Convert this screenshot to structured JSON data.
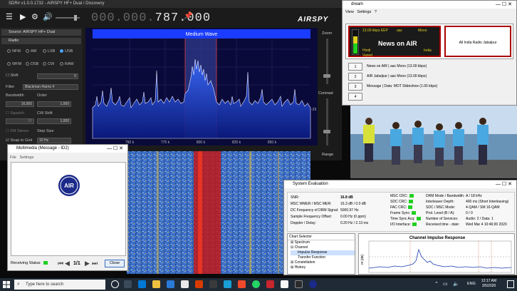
{
  "sdr": {
    "title": "SDR# v1.0.0.1732 - AIRSPY HF+ Dual / Discovery",
    "freq_prefix": "000.000.",
    "freq_main": "787.000",
    "logo": "AIRSPY",
    "source": "Source: AIRSPY HF+ Dual",
    "radio_section": "Radio",
    "modes": [
      "NFM",
      "AM",
      "LSB",
      "USB",
      "WFM",
      "DSB",
      "CW",
      "RAW"
    ],
    "selected_mode": "USB",
    "shift_label": "Shift",
    "shift_value": "0",
    "filter_label": "Filter",
    "filter_value": "Blackman-Harris 4",
    "bandwidth_label": "Bandwidth",
    "order_label": "Order",
    "bandwidth_value": "16,000",
    "order_value": "1,000",
    "squelch_label": "Squelch",
    "cw_shift_label": "CW Shift",
    "squelch_value": "50",
    "cw_shift_value": "1,000",
    "fm_stereo_label": "FM Stereo",
    "step_size_label": "Step Size",
    "snap_label": "Snap to Grid",
    "step_value": "10 Hz",
    "spectrum_label": "Medium Wave",
    "x_ticks": [
      "750 k",
      "775 k",
      "800 k",
      "825 k",
      "850 k"
    ],
    "y_tick": "-29",
    "zoom_label": "Zoom",
    "contrast_label": "Contrast",
    "range_label": "Range"
  },
  "dream": {
    "title": "dream",
    "menu": [
      "View",
      "Settings",
      "?"
    ],
    "bitrate": "13.00 kbps EEP",
    "codec": "aac",
    "channel": "Mono",
    "station": "News on AIR",
    "language": "Hindi",
    "country": "India",
    "program_type": "Varied",
    "right_text": "All India Radio Jabalpur",
    "services": [
      {
        "num": "1",
        "text": "News on AIR  |  aac Mono (13.00 kbps)"
      },
      {
        "num": "2",
        "text": "AIR Jabalpur  |  aac Mono (13.00 kbps)"
      },
      {
        "num": "3",
        "text": "Message  |  Data: MOT Slideshow (1.00 kbps)"
      },
      {
        "num": "4",
        "text": ""
      }
    ]
  },
  "multimedia": {
    "title": "Multimedia (Message - ID2)",
    "menu": [
      "File",
      "Settings"
    ],
    "logo_text": "AIR",
    "receiving_label": "Receiving Status:",
    "page": "1/1",
    "close_label": "Close"
  },
  "syseval": {
    "title": "System Evaluation",
    "left_rows": [
      {
        "label": "SNR:",
        "value": "16.8 dB"
      },
      {
        "label": "MSC WMER / MSC MER:",
        "value": "16.3 dB / 0.0 dB"
      },
      {
        "label": "DC Frequency of DRM Signal:",
        "value": "5000.97 Hz"
      },
      {
        "label": "Sample Frequency Offset:",
        "value": "0.00 Hz (0 ppm)"
      },
      {
        "label": "Doppler / Delay:",
        "value": "0.20 Hz / 2.13 ms"
      }
    ],
    "crc_rows": [
      "MSC CRC:",
      "SDC CRC:",
      "FAC CRC:",
      "Frame Sync:",
      "Time Sync Acq:",
      "I/O Interface:"
    ],
    "right_rows": [
      {
        "label": "DRM Mode / Bandwidth:",
        "value": "A / 18 kHz"
      },
      {
        "label": "Interleaver Depth:",
        "value": "400 ms (Short Interleaving)"
      },
      {
        "label": "SDC / MSC Mode:",
        "value": "4-QAM / SM 16-QAM"
      },
      {
        "label": "Prot. Level (B / A):",
        "value": "0 / 0"
      },
      {
        "label": "Number of Services:",
        "value": "Audio: 2 / Data: 1"
      },
      {
        "label": "Received time - date:",
        "value": "Wed Mar 4 10:46:00 2020"
      }
    ],
    "chart_selector_title": "Chart Selector",
    "tree": [
      "Spectrum",
      "Channel",
      "Impulse Response",
      "Transfer Function",
      "Constellation",
      "History"
    ],
    "chart_title": "Channel Impulse Response",
    "ylabel": "IR [dB]"
  },
  "taskbar": {
    "search_placeholder": "Type here to search",
    "lang": "ENG",
    "time": "12:17 AM",
    "date": "3/5/2020"
  },
  "colors": {
    "spectrum_bg": "#0a0a3a",
    "spectrum_header": "#1a3cff",
    "led_green": "#20d020",
    "dream_red": "#a00000"
  }
}
